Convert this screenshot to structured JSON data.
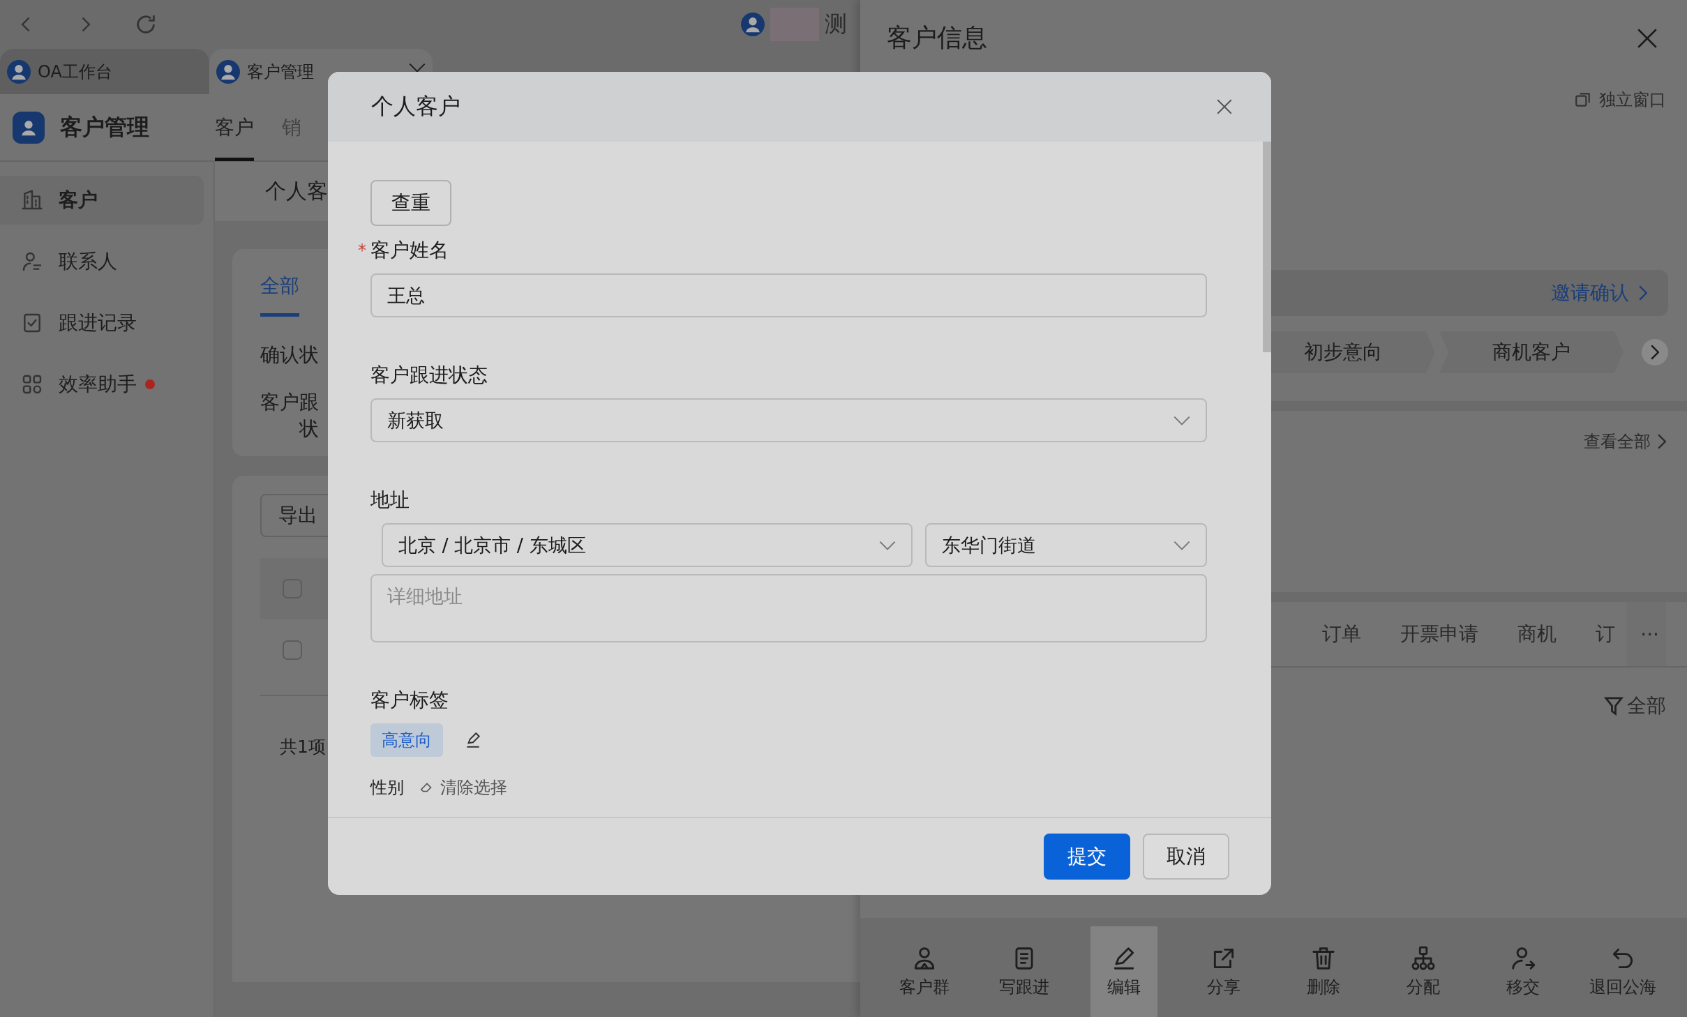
{
  "browser": {
    "tabs": [
      {
        "label": "OA工作台",
        "selected": false
      },
      {
        "label": "客户管理",
        "selected": true
      }
    ],
    "account_name": "测"
  },
  "app": {
    "title": "客户管理",
    "nav_tabs": [
      {
        "label": "客户",
        "selected": true
      },
      {
        "label": "销",
        "selected": false
      }
    ],
    "sidebar": {
      "items": [
        {
          "label": "客户",
          "selected": true,
          "badge": false
        },
        {
          "label": "联系人",
          "selected": false,
          "badge": false
        },
        {
          "label": "跟进记录",
          "selected": false,
          "badge": false
        },
        {
          "label": "效率助手",
          "selected": false,
          "badge": true
        }
      ]
    },
    "content": {
      "page_tab": "个人客",
      "filter_tabs": [
        {
          "label": "全部",
          "selected": true
        }
      ],
      "filters": [
        {
          "lines": [
            "确认状"
          ]
        },
        {
          "lines": [
            "客户跟",
            "状"
          ]
        }
      ],
      "export_button": "导出",
      "rows": [
        {
          "checked": false
        },
        {
          "checked": false
        }
      ],
      "total": "共1项"
    }
  },
  "drawer": {
    "title": "客户信息",
    "open_window": "独立窗口",
    "invite": "邀请确认",
    "stages": [
      "初步意向",
      "商机客户"
    ],
    "view_all": "查看全部",
    "tabs": [
      "订单",
      "开票申请",
      "商机",
      "订"
    ],
    "more": "···",
    "filter": "全部",
    "actions": [
      {
        "label": "客户群",
        "selected": false
      },
      {
        "label": "写跟进",
        "selected": false
      },
      {
        "label": "编辑",
        "selected": true
      },
      {
        "label": "分享",
        "selected": false
      },
      {
        "label": "删除",
        "selected": false
      },
      {
        "label": "分配",
        "selected": false
      },
      {
        "label": "移交",
        "selected": false
      },
      {
        "label": "退回公海",
        "selected": false
      }
    ]
  },
  "dialog": {
    "title": "个人客户",
    "check_button": "查重",
    "name": {
      "label": "客户姓名",
      "required_mark": "*",
      "value": "王总"
    },
    "status": {
      "label": "客户跟进状态",
      "value": "新获取"
    },
    "address": {
      "label": "地址",
      "region": "北京 / 北京市 / 东城区",
      "street": "东华门街道",
      "placeholder": "详细地址"
    },
    "tags": {
      "label": "客户标签",
      "items": [
        "高意向"
      ]
    },
    "gender": {
      "label": "性别",
      "clear": "清除选择"
    },
    "buttons": [
      {
        "label": "提交",
        "kind": "primary"
      },
      {
        "label": "取消",
        "kind": "default"
      }
    ]
  }
}
